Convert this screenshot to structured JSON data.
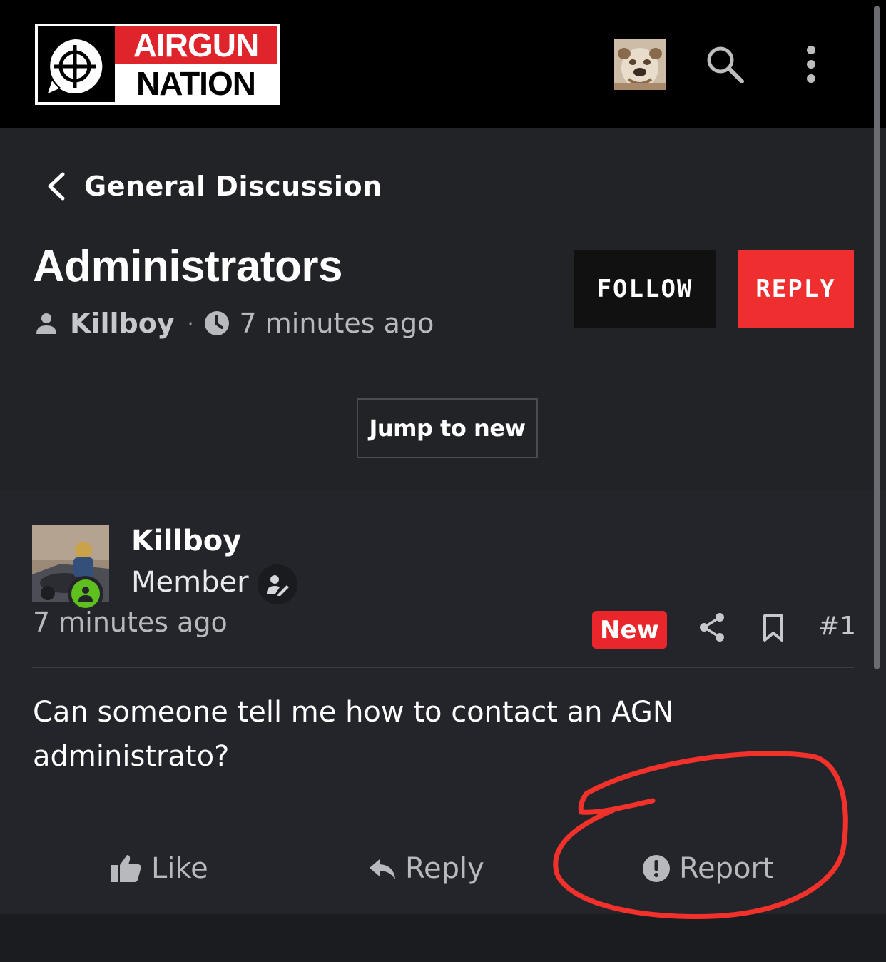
{
  "header": {
    "logo": {
      "top_text": "AIRGUN",
      "bottom_text": "NATION"
    },
    "icons": {
      "avatar": "bulldog-avatar",
      "search": "search-icon",
      "menu": "more-vertical-icon"
    }
  },
  "thread": {
    "breadcrumb": "General Discussion",
    "title": "Administrators",
    "author": "Killboy",
    "separator": "·",
    "time": "7 minutes ago",
    "follow_label": "FOLLOW",
    "reply_label": "REPLY",
    "jump_label": "Jump to new"
  },
  "post": {
    "author": "Killboy",
    "role": "Member",
    "time": "7 minutes ago",
    "badge": "New",
    "number": "#1",
    "body": "Can someone tell me how to contact an AGN administrato?",
    "actions": {
      "like": "Like",
      "reply": "Reply",
      "report": "Report"
    }
  },
  "colors": {
    "accent_red": "#ef2f2f",
    "online_green": "#5fbf1f",
    "annotation_red": "#f2312a"
  }
}
